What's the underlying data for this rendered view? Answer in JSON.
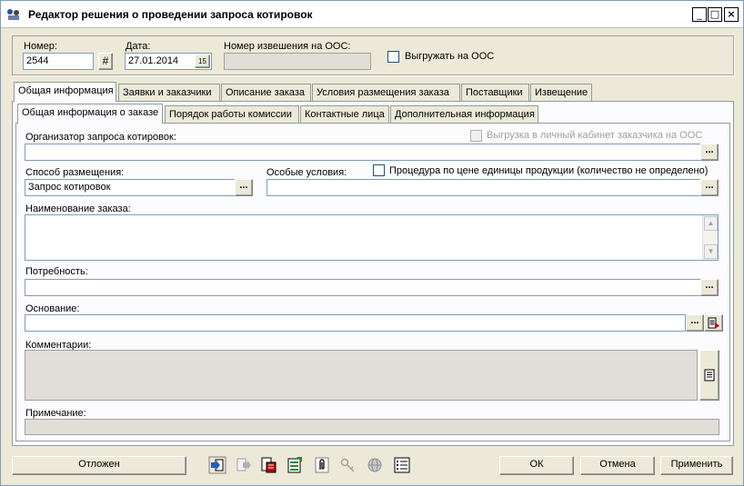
{
  "window": {
    "title": "Редактор решения о проведении запроса котировок",
    "min_label": "_",
    "max_label": "□",
    "close_label": "×"
  },
  "header": {
    "number_label": "Номер:",
    "number_value": "2544",
    "date_label": "Дата:",
    "date_value": "27.01.2014",
    "date_button": "15",
    "number_button": "#",
    "oos_number_label": "Номер извешения на ООС:",
    "oos_number_value": "",
    "upload_oos_label": "Выгружать на ООС"
  },
  "tabs": [
    {
      "label": "Общая информация"
    },
    {
      "label": "Заявки и заказчики"
    },
    {
      "label": "Описание заказа"
    },
    {
      "label": "Условия размещения заказа"
    },
    {
      "label": "Поставщики"
    },
    {
      "label": "Извещение"
    }
  ],
  "subtabs": [
    {
      "label": "Общая информация о заказе"
    },
    {
      "label": "Порядок работы комиссии"
    },
    {
      "label": "Контактные лица"
    },
    {
      "label": "Дополнительная информация"
    }
  ],
  "form": {
    "organizer_label": "Организатор запроса котировок:",
    "organizer_value": "",
    "customer_cabinet_label": "Выгрузка в личный кабинет заказчика на ООС",
    "method_label": "Способ размещения:",
    "method_value": "Запрос котировок",
    "special_label": "Особые условия:",
    "special_value": "",
    "unit_price_label": "Процедура по цене единицы продукции (количество не определено)",
    "order_name_label": "Наименование заказа:",
    "order_name_value": "",
    "need_label": "Потребность:",
    "need_value": "",
    "basis_label": "Основание:",
    "basis_value": "",
    "comments_label": "Комментарии:",
    "comments_value": "",
    "note_label": "Примечание:",
    "note_value": "",
    "ellipsis": "..."
  },
  "footer": {
    "postponed_label": "Отложен",
    "ok_label": "ОК",
    "cancel_label": "Отмена",
    "apply_label": "Применить"
  },
  "toolbar_icons": [
    "export-icon",
    "import-icon",
    "report-icon",
    "excel-icon",
    "attachment-icon",
    "key-icon",
    "globe-icon",
    "list-icon"
  ],
  "colors": {
    "window_bg": "#ece9d8",
    "panel_bg": "#fcfcfe",
    "field_border": "#7f9db9"
  }
}
